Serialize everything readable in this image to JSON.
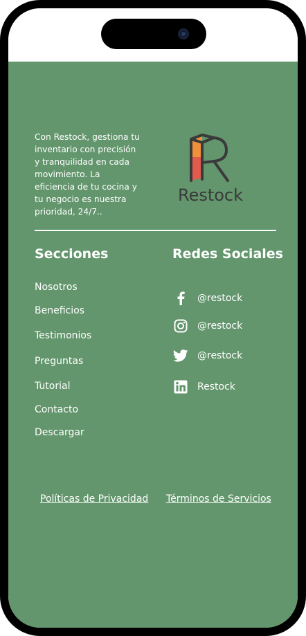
{
  "intro": {
    "lines": [
      "Con Restock, gestiona tu",
      "inventario con precisión",
      "y tranquilidad en cada",
      "movimiento. La",
      "eficiencia de tu cocina y",
      "tu negocio es nuestra",
      "prioridad, 24/7.."
    ]
  },
  "logo": {
    "text": "Restock",
    "colors": {
      "top": "#f0913a",
      "bottom": "#e05a4e",
      "outline": "#3a3a3a"
    }
  },
  "sections": {
    "title": "Secciones",
    "links": [
      "Nosotros",
      "Beneficios",
      "Testimonios",
      "Preguntas",
      "Tutorial",
      "Contacto",
      "Descargar"
    ]
  },
  "social": {
    "title": "Redes Sociales",
    "items": [
      {
        "icon": "facebook-icon",
        "label": "@restock"
      },
      {
        "icon": "instagram-icon",
        "label": "@restock"
      },
      {
        "icon": "twitter-icon",
        "label": "@restock"
      },
      {
        "icon": "linkedin-icon",
        "label": "Restock"
      }
    ]
  },
  "legal": {
    "privacy": "Políticas de Privacidad",
    "terms": "Términos de Servicios"
  },
  "colors": {
    "background": "#63966d",
    "text": "#ffffff",
    "frame": "#000000"
  }
}
